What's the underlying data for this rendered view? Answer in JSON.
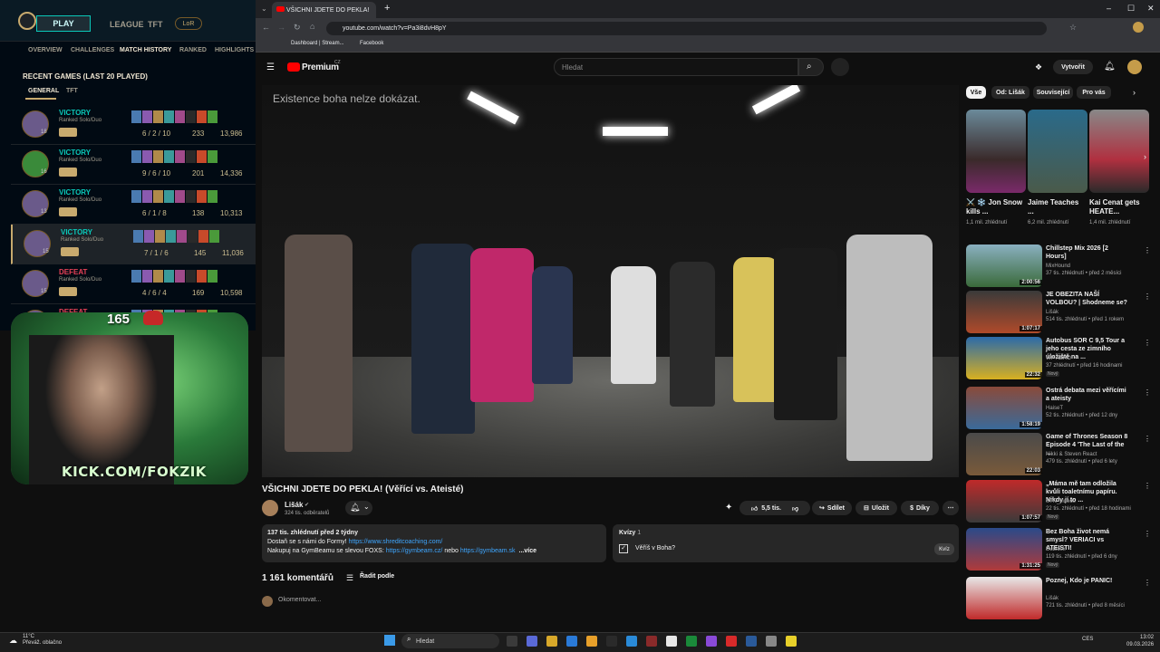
{
  "lol": {
    "play": "PLAY",
    "nav": [
      "LEAGUE",
      "TFT"
    ],
    "lor": "LoR",
    "subnav": [
      "OVERVIEW",
      "CHALLENGES",
      "MATCH HISTORY",
      "RANKED",
      "HIGHLIGHTS"
    ],
    "recent_title": "RECENT GAMES (LAST 20 PLAYED)",
    "tabs": [
      "GENERAL",
      "TFT"
    ],
    "games": [
      {
        "result": "VICTORY",
        "mode": "Ranked Solo/Duo",
        "kda": "6 / 2 / 10",
        "cs": "233",
        "gold": "13,986",
        "level": "18"
      },
      {
        "result": "VICTORY",
        "mode": "Ranked Solo/Duo",
        "kda": "9 / 6 / 10",
        "cs": "201",
        "gold": "14,336",
        "level": "16"
      },
      {
        "result": "VICTORY",
        "mode": "Ranked Solo/Duo",
        "kda": "6 / 1 / 8",
        "cs": "138",
        "gold": "10,313",
        "level": "13"
      },
      {
        "result": "VICTORY",
        "mode": "Ranked Solo/Duo",
        "kda": "7 / 1 / 6",
        "cs": "145",
        "gold": "11,036",
        "level": "15"
      },
      {
        "result": "DEFEAT",
        "mode": "Ranked Solo/Duo",
        "kda": "4 / 6 / 4",
        "cs": "169",
        "gold": "10,598",
        "level": "15"
      },
      {
        "result": "DEFEAT",
        "mode": "",
        "kda": "",
        "cs": "",
        "gold": "",
        "level": ""
      }
    ]
  },
  "stream": {
    "count": "165",
    "kick": "KICK.COM/FOKZIK"
  },
  "browser": {
    "tab_title": "VŠICHNI JDETE DO PEKLA!",
    "url": "youtube.com/watch?v=Pa3i8dvH8pY",
    "bookmarks": [
      "Dashboard | Stream...",
      "Facebook"
    ]
  },
  "yt": {
    "logo": "Premium",
    "logo_sup": "CZ",
    "search_placeholder": "Hledat",
    "create": "Vytvořit",
    "video_caption": "Existence boha nelze dokázat.",
    "title": "VŠICHNI JDETE DO PEKLA! (Věřící vs. Ateisté)",
    "channel": "Lišák",
    "subs": "324 tis. odběratelů",
    "likes": "5,5 tis.",
    "share": "Sdílet",
    "save": "Uložit",
    "thanks": "Díky",
    "desc_line1": "137 tis. zhlédnutí  před 2 týdny",
    "desc_line2_text": "Dostaň se s námi do Formy! ",
    "desc_line2_link": "https://www.shreditcoaching.com/",
    "desc_line3_text": "Nakupuj na GymBeamu se slevou FOXS: ",
    "desc_line3_link1": "https://gymbeam.cz/",
    "desc_line3_mid": " nebo ",
    "desc_line3_link2": "https://gymbeam.sk",
    "desc_more": "...více",
    "quiz_label": "Kvízy",
    "quiz_count": "1",
    "quiz_question": "Věříš v Boha?",
    "quiz_button": "Kvíz",
    "comments": "1 161 komentářů",
    "sort": "Řadit podle",
    "add_comment": "Okomentovat..."
  },
  "sidebar": {
    "chips": [
      "Vše",
      "Od: Lišák",
      "Související",
      "Pro vás"
    ],
    "shorts": [
      {
        "title": "⚔️ ❄️ Jon Snow kills ...",
        "views": "1,1 mil. zhlédnutí"
      },
      {
        "title": "Jaime Teaches ...",
        "views": "6,2 mil. zhlédnutí"
      },
      {
        "title": "Kai Cenat gets HEATE...",
        "views": "1,4 mil. zhlédnutí"
      }
    ],
    "recs": [
      {
        "title": "Chillstep Mix 2026 [2 Hours]",
        "channel": "MixHound",
        "meta": "37 tis. zhlédnutí • před 2 měsíci",
        "duration": "2:00:56",
        "badge": ""
      },
      {
        "title": "JE OBEZITA NAŠÍ VOLBOU? | Shodneme se?",
        "channel": "Lišák",
        "meta": "514 tis. zhlédnutí • před 1 rokem",
        "duration": "1:07:17",
        "badge": ""
      },
      {
        "title": "Autobus SOR C 9,5 Tour a jeho cesta ze zimního úložiště na ...",
        "channel": "WP AERO",
        "meta": "37 zhlédnutí • před 16 hodinami",
        "duration": "22:32",
        "badge": "Nový"
      },
      {
        "title": "Ostrá debata mezi věřícími a ateisty",
        "channel": "HaiseT",
        "meta": "52 tis. zhlédnutí • před 12 dny",
        "duration": "1:58:19",
        "badge": ""
      },
      {
        "title": "Game of Thrones Season 8 Episode 4 'The Last of the ...",
        "channel": "Nikki & Steven React",
        "meta": "479 tis. zhlédnutí • před 6 lety",
        "duration": "22:03",
        "badge": ""
      },
      {
        "title": "„Máma mě tam odložila kvůli toaletnímu papíru. Nikdy jí to ...",
        "channel": "STN_videos",
        "meta": "22 tis. zhlédnutí • před 18 hodinami",
        "duration": "1:07:57",
        "badge": "Nový"
      },
      {
        "title": "Bez Boha život nemá smysl? VERIACI vs ATEISTI!",
        "channel": "Dubiosk",
        "meta": "119 tis. zhlédnutí • před 6 dny",
        "duration": "1:31:25",
        "badge": "Nový"
      },
      {
        "title": "Poznej, Kdo je PANIC!",
        "channel": "Lišák",
        "meta": "721 tis. zhlédnutí • před 8 měsíci",
        "duration": "",
        "badge": ""
      }
    ]
  },
  "taskbar": {
    "weather_temp": "11°C",
    "weather_desc": "Převáž. oblačno",
    "search": "Hledat",
    "lang": "CES",
    "time": "13:02",
    "date": "09.03.2026"
  },
  "colors": {
    "victory": "#0ac8b9",
    "defeat": "#e84057",
    "yt_red": "#ff0000",
    "kick_green": "#53fc18"
  }
}
